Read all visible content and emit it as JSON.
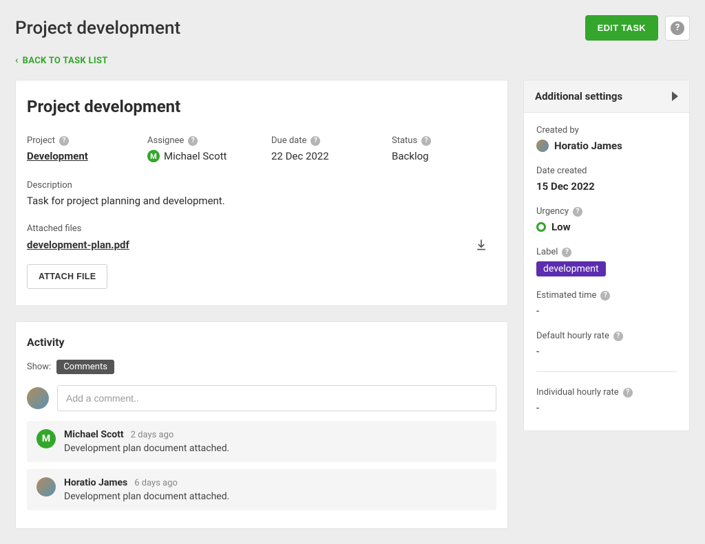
{
  "header": {
    "page_title": "Project development",
    "edit_button": "EDIT TASK",
    "back_link": "BACK TO TASK LIST"
  },
  "task": {
    "title": "Project development",
    "fields": {
      "project": {
        "label": "Project",
        "value": "Development"
      },
      "assignee": {
        "label": "Assignee",
        "name": "Michael Scott",
        "initial": "M"
      },
      "due_date": {
        "label": "Due date",
        "value": "22 Dec 2022"
      },
      "status": {
        "label": "Status",
        "value": "Backlog"
      }
    },
    "description": {
      "label": "Description",
      "text": "Task for project planning and development."
    },
    "attachments": {
      "label": "Attached files",
      "file": "development-plan.pdf",
      "attach_button": "ATTACH FILE"
    }
  },
  "activity": {
    "title": "Activity",
    "show_label": "Show:",
    "filter": "Comments",
    "input_placeholder": "Add a comment..",
    "comments": [
      {
        "author": "Michael Scott",
        "initial": "M",
        "time": "2 days ago",
        "text": "Development plan document attached.",
        "avatar_type": "letter"
      },
      {
        "author": "Horatio James",
        "time": "6 days ago",
        "text": "Development plan document attached.",
        "avatar_type": "photo"
      }
    ]
  },
  "sidebar": {
    "header": "Additional settings",
    "created_by": {
      "label": "Created by",
      "name": "Horatio James"
    },
    "date_created": {
      "label": "Date created",
      "value": "15 Dec 2022"
    },
    "urgency": {
      "label": "Urgency",
      "value": "Low"
    },
    "label_field": {
      "label": "Label",
      "value": "development"
    },
    "estimated_time": {
      "label": "Estimated time",
      "value": "-"
    },
    "default_rate": {
      "label": "Default hourly rate",
      "value": "-"
    },
    "individual_rate": {
      "label": "Individual hourly rate",
      "value": "-"
    }
  }
}
